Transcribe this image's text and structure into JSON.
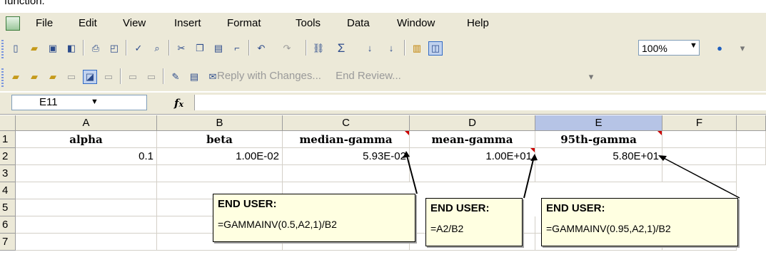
{
  "caption": "function:",
  "menu": [
    "File",
    "Edit",
    "View",
    "Insert",
    "Format",
    "Tools",
    "Data",
    "Window",
    "Help"
  ],
  "toolbar": {
    "zoom": "100%",
    "reply_label": "Reply with Changes...",
    "end_review_label": "End Review..."
  },
  "formula_bar": {
    "cell_ref": "E11",
    "fx": "fx",
    "content": ""
  },
  "columns": [
    "A",
    "B",
    "C",
    "D",
    "E",
    "F"
  ],
  "rows": [
    "1",
    "2",
    "3",
    "4",
    "5",
    "6",
    "7"
  ],
  "cells": {
    "A1": "alpha",
    "B1": "beta",
    "C1": "median-gamma",
    "D1": "mean-gamma",
    "E1": "95th-gamma",
    "A2": "0.1",
    "B2": "1.00E-02",
    "C2": "5.93E-02",
    "D2": "1.00E+01",
    "E2": "5.80E+01"
  },
  "notes": [
    {
      "title": "END USER:",
      "formula": "=GAMMAINV(0.5,A2,1)/B2"
    },
    {
      "title": "END USER:",
      "formula": "=A2/B2"
    },
    {
      "title": "END USER:",
      "formula": "=GAMMAINV(0.95,A2,1)/B2"
    }
  ]
}
